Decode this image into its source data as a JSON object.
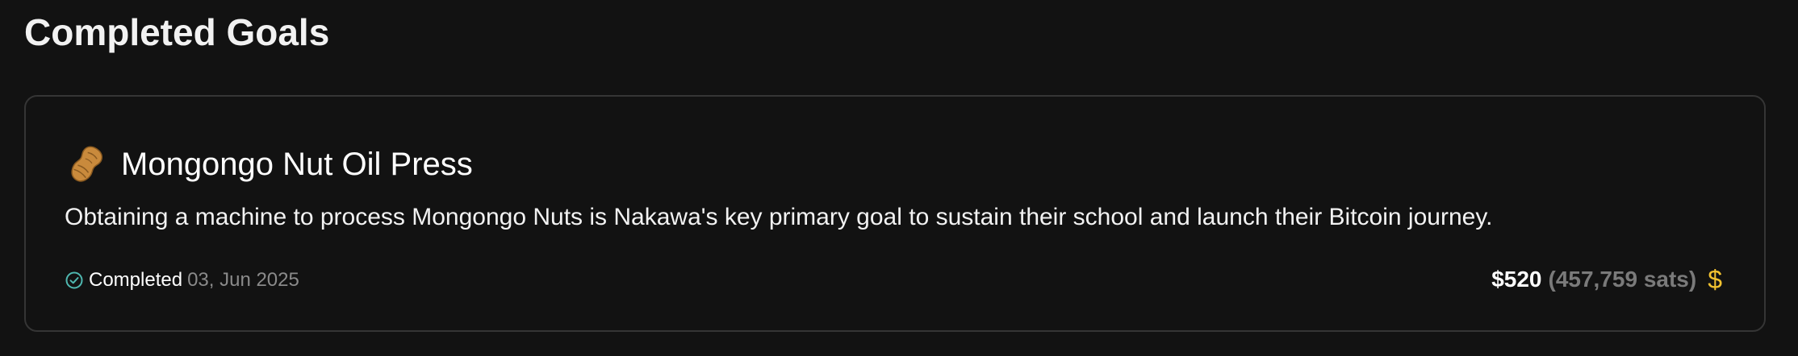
{
  "section": {
    "title": "Completed Goals"
  },
  "goal": {
    "icon": "peanut-icon",
    "title": "Mongongo Nut Oil Press",
    "description": "Obtaining a machine to process Mongongo Nuts is Nakawa's key primary goal to sustain their school and launch their Bitcoin journey.",
    "status_label": "Completed",
    "status_date": "03, Jun 2025",
    "amount_usd": "$520",
    "amount_sats": "(457,759 sats)",
    "currency_icon": "dollar-icon"
  },
  "colors": {
    "background": "#121212",
    "border": "#353535",
    "check": "#4fb8b0",
    "dollar": "#f2c230",
    "muted": "#8a8a8a"
  }
}
